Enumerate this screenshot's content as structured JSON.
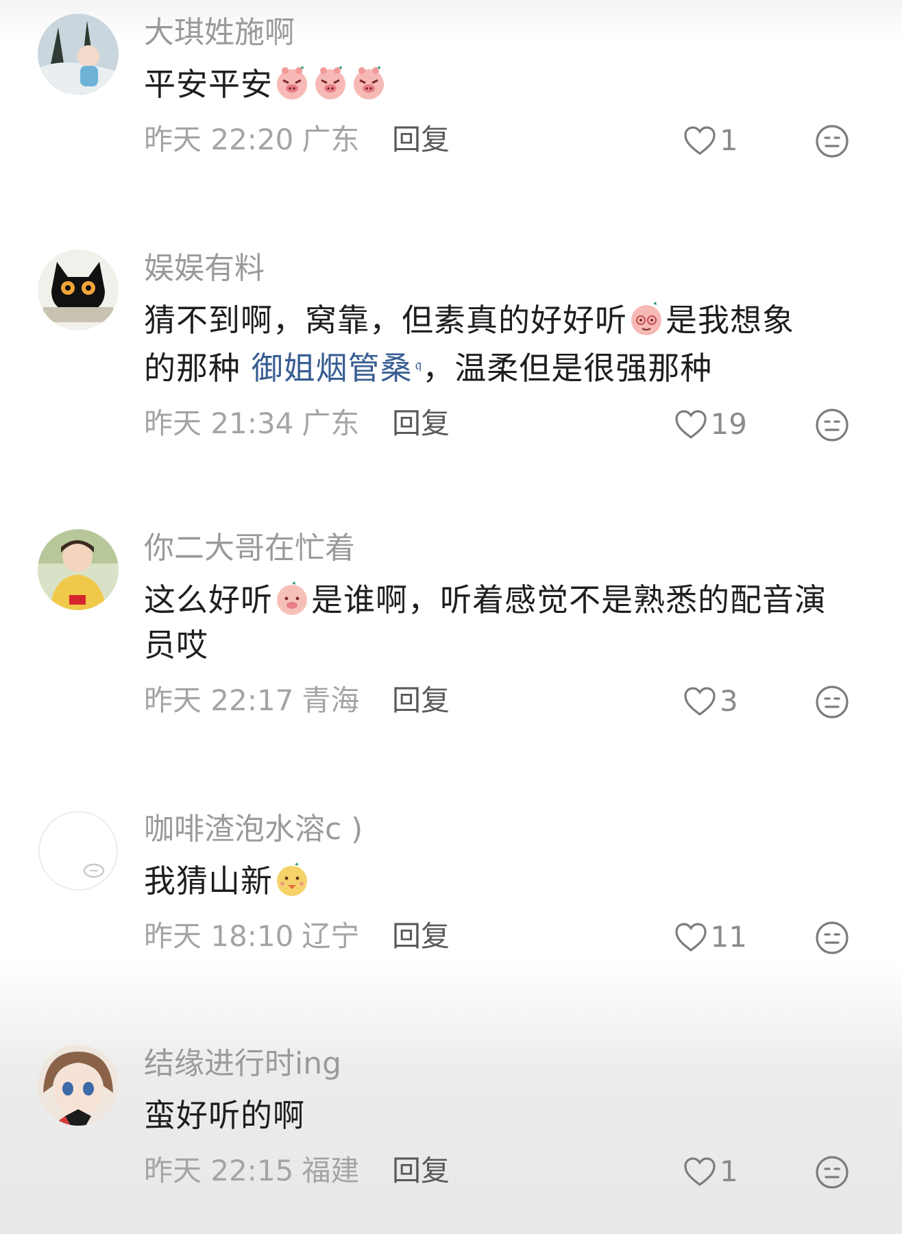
{
  "comments": [
    {
      "username": "大琪姓施啊",
      "text_before": "平安平安",
      "emojis": [
        "pig-face-emoji",
        "pig-face-emoji",
        "pig-face-emoji"
      ],
      "time": "昨天 22:20",
      "location": "广东",
      "reply": "回复",
      "likes": "1"
    },
    {
      "username": "娱娱有料",
      "text_line1_a": "猜不到啊，窝靠，但素真的好好听",
      "text_line1_b": "是我想象",
      "text_line2_a": "的那种 ",
      "link": "御姐烟管桑",
      "text_line2_b": "，温柔但是很强那种",
      "time": "昨天 21:34",
      "location": "广东",
      "reply": "回复",
      "likes": "19"
    },
    {
      "username": "你二大哥在忙着",
      "text_a": "这么好听",
      "text_b": "是谁啊，听着感觉不是熟悉的配音演员哎",
      "time": "昨天 22:17",
      "location": "青海",
      "reply": "回复",
      "likes": "3"
    },
    {
      "username": "咖啡渣泡水溶c )",
      "text_a": "我猜山新",
      "time": "昨天 18:10",
      "location": "辽宁",
      "reply": "回复",
      "likes": "11"
    },
    {
      "username": "结缘进行时ing",
      "text_a": "蛮好听的啊",
      "time": "昨天 22:15",
      "location": "福建",
      "reply": "回复",
      "likes": "1"
    }
  ],
  "icons": {
    "like": "heart-outline-icon",
    "dislike": "neutral-face-icon",
    "link": "search-icon"
  },
  "colors": {
    "link": "#385e92",
    "username": "#9a9a9a",
    "text": "#1e1e1e",
    "meta": "#a4a4a4"
  }
}
